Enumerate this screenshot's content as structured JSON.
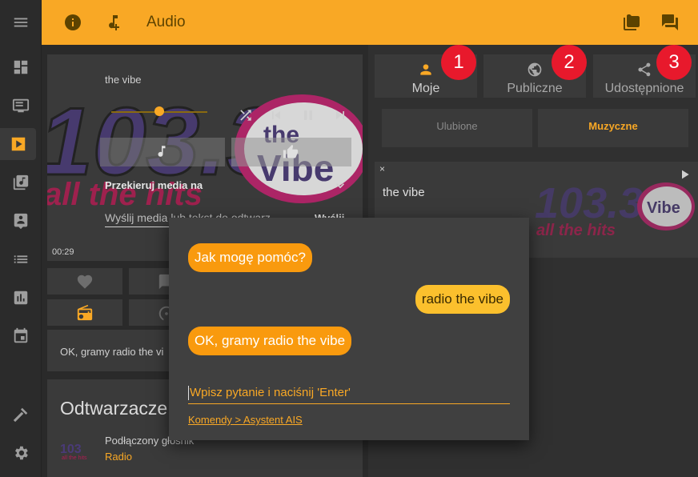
{
  "app": {
    "title": "Audio",
    "accent": "#f9a825",
    "topbar_icons": [
      "info-icon",
      "add-music-icon",
      "folder-icon",
      "chat-icon"
    ]
  },
  "sidebar": {
    "items": [
      {
        "icon": "menu-icon"
      },
      {
        "icon": "dashboard-icon"
      },
      {
        "icon": "monitor-icon"
      },
      {
        "icon": "play-icon",
        "active": true
      },
      {
        "icon": "library-music-icon"
      },
      {
        "icon": "assistant-icon"
      },
      {
        "icon": "list-icon"
      },
      {
        "icon": "chart-icon"
      },
      {
        "icon": "calendar-icon"
      },
      {
        "icon": "hammer-icon"
      },
      {
        "icon": "settings-icon"
      }
    ]
  },
  "player": {
    "track": "the vibe",
    "progress": 0.5,
    "redirect_label": "Przekieruj media na",
    "send_placeholder": "Wyślij media lub tekst do odtwarz",
    "send_button": "Wyślij",
    "time": "00:29"
  },
  "status": {
    "text": "OK, gramy radio the vi"
  },
  "players": {
    "title": "Odtwarzacze",
    "item_name": "Podłączony głośnik",
    "item_sub": "Radio"
  },
  "tabs": [
    {
      "label": "Moje",
      "icon": "person-icon",
      "badge": "1"
    },
    {
      "label": "Publiczne",
      "icon": "globe-icon",
      "badge": "2"
    },
    {
      "label": "Udostępnione",
      "icon": "share-icon",
      "badge": "3"
    }
  ],
  "subtabs": [
    {
      "label": "Ulubione",
      "color": "#8a8a8a"
    },
    {
      "label": "Muzyczne",
      "color": "#f9a825"
    }
  ],
  "item": {
    "close": "×",
    "name": "the vibe"
  },
  "dialog": {
    "messages": [
      {
        "from": "bot",
        "text": "Jak mogę pomóc?"
      },
      {
        "from": "user",
        "text": "radio the vibe"
      },
      {
        "from": "bot",
        "text": "OK, gramy radio the vibe"
      }
    ],
    "input_placeholder": "Wpisz pytanie i naciśnij 'Enter'",
    "link": "Komendy > Asystent AIS"
  }
}
